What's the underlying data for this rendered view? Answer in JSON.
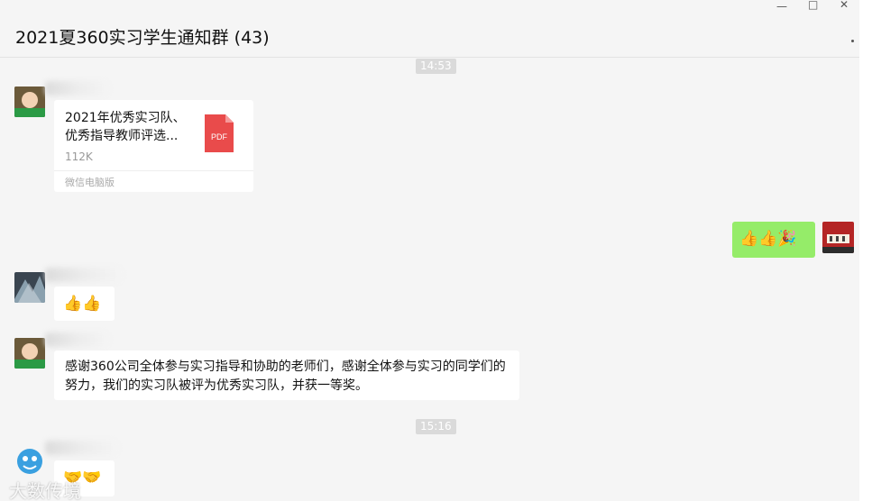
{
  "window": {
    "title": "2021夏360实习学生通知群 (43)",
    "controls": {
      "minimize": "—",
      "maximize": "□",
      "close": "✕"
    }
  },
  "messages": {
    "time1": "14:53",
    "file": {
      "name": "2021年优秀实习队、优秀指导教师评选...",
      "size": "112K",
      "source": "微信电脑版",
      "icon_label": "PDF"
    },
    "self_emojis": "👍👍🎉",
    "reply_emojis": "👍👍",
    "announcement": "感谢360公司全体参与实习指导和协助的老师们，感谢全体参与实习的同学们的努力，我们的实习队被评为优秀实习队，并获一等奖。",
    "time2": "15:16",
    "last_emojis": "🤝🤝"
  },
  "watermark": "大数传境",
  "colors": {
    "self_bubble": "#95ec69",
    "time_badge": "#dadada",
    "pdf_red": "#e94b4b"
  }
}
